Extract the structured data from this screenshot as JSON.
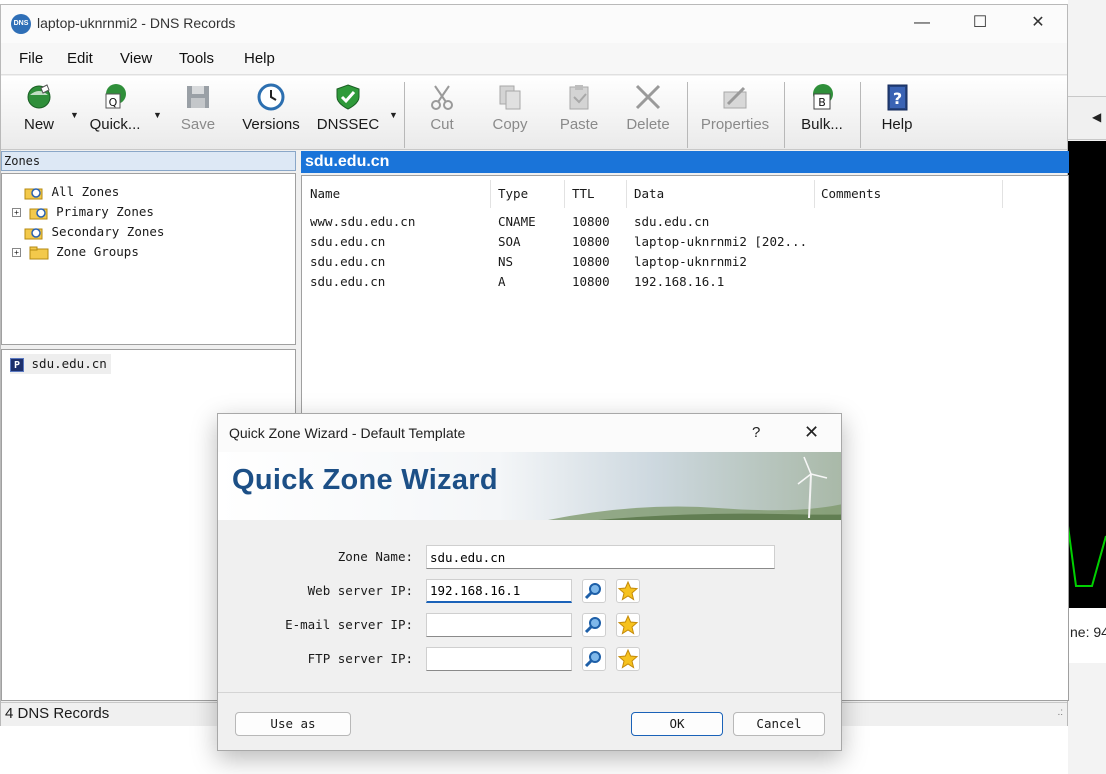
{
  "window": {
    "icon_text": "DNS",
    "title": "laptop-uknrnmi2 - DNS Records",
    "minimize": "—",
    "maximize": "☐",
    "close": "✕"
  },
  "menu": [
    "File",
    "Edit",
    "View",
    "Tools",
    "Help"
  ],
  "toolbar": {
    "new": "New",
    "quick": "Quick...",
    "save": "Save",
    "versions": "Versions",
    "dnssec": "DNSSEC",
    "cut": "Cut",
    "copy": "Copy",
    "paste": "Paste",
    "delete": "Delete",
    "properties": "Properties",
    "bulk": "Bulk...",
    "help": "Help",
    "bulk_badge": "B",
    "help_badge": "?"
  },
  "zones": {
    "header": "Zones",
    "tree": [
      "All Zones",
      "Primary Zones",
      "Secondary Zones",
      "Zone Groups"
    ],
    "expander": "+",
    "file_badge": "P",
    "selected_file": "sdu.edu.cn"
  },
  "records": {
    "zone_title": "sdu.edu.cn",
    "columns": [
      "Name",
      "Type",
      "TTL",
      "Data",
      "Comments"
    ],
    "rows": [
      {
        "name": "www.sdu.edu.cn",
        "type": "CNAME",
        "ttl": "10800",
        "data": "sdu.edu.cn",
        "comments": ""
      },
      {
        "name": "sdu.edu.cn",
        "type": "SOA",
        "ttl": "10800",
        "data": "laptop-uknrnmi2 [202...",
        "comments": ""
      },
      {
        "name": "sdu.edu.cn",
        "type": "NS",
        "ttl": "10800",
        "data": "laptop-uknrnmi2",
        "comments": ""
      },
      {
        "name": "sdu.edu.cn",
        "type": "A",
        "ttl": "10800",
        "data": "192.168.16.1",
        "comments": ""
      }
    ]
  },
  "status": {
    "text": "4 DNS Records",
    "grip": ".:"
  },
  "background": {
    "arrow": "◀",
    "label": "ne: 94"
  },
  "dialog": {
    "title": "Quick Zone Wizard - Default Template",
    "help": "?",
    "close": "✕",
    "banner": "Quick Zone Wizard",
    "fields": [
      {
        "label": "Zone Name:",
        "value": ""
      },
      {
        "label": "Web server IP:",
        "value": ""
      },
      {
        "label": "E-mail server IP:",
        "value": ""
      },
      {
        "label": "FTP server IP:",
        "value": ""
      }
    ],
    "zone_name": "sdu.edu.cn",
    "web_ip": "192.168.16.1",
    "email_ip": "",
    "ftp_ip": "",
    "use_as": "Use as",
    "ok": "OK",
    "cancel": "Cancel"
  },
  "colors": {
    "accent": "#1a74d9",
    "banner_text": "#1c4f86",
    "zones_header": "#dde8f5"
  }
}
